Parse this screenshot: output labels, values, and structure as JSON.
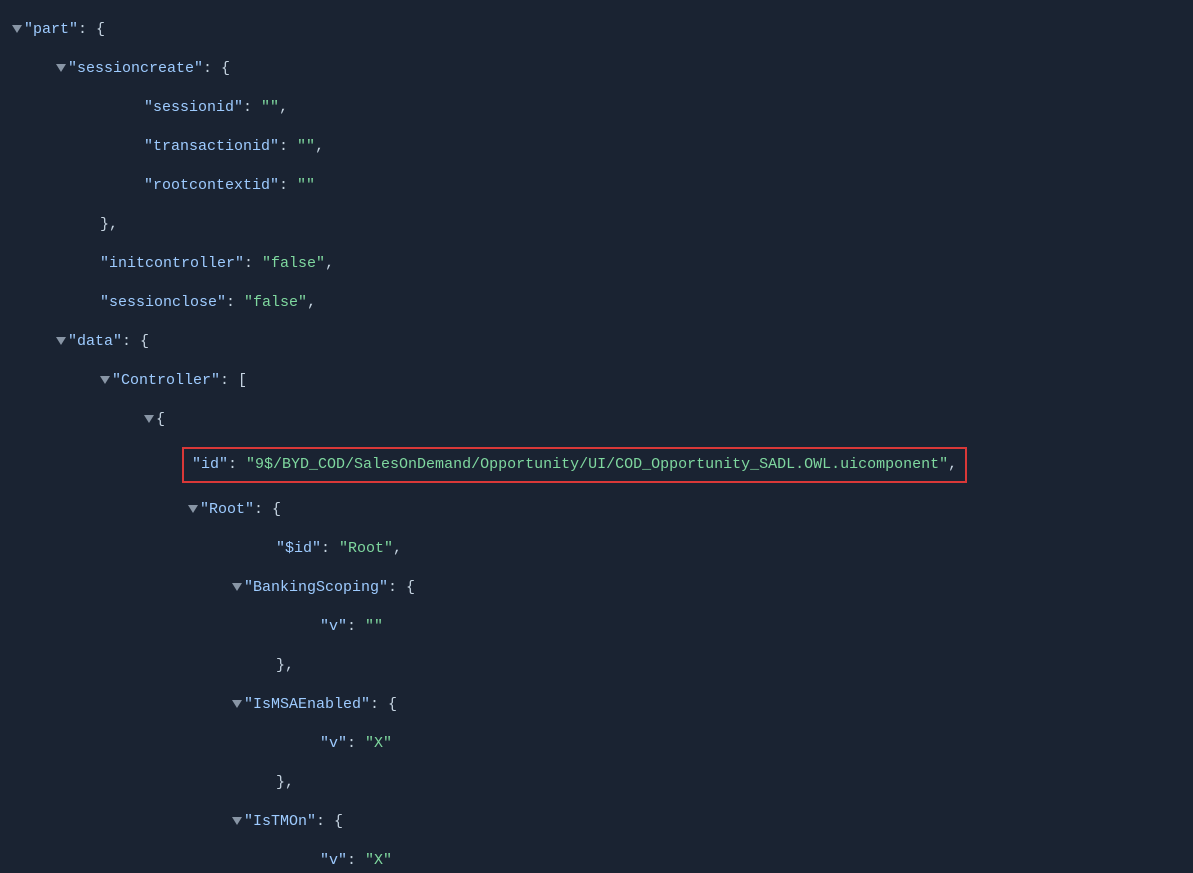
{
  "keys": {
    "part": "\"part\"",
    "sessioncreate": "\"sessioncreate\"",
    "sessionid": "\"sessionid\"",
    "transactionid": "\"transactionid\"",
    "rootcontextid": "\"rootcontextid\"",
    "initcontroller": "\"initcontroller\"",
    "sessionclose": "\"sessionclose\"",
    "data": "\"data\"",
    "controller": "\"Controller\"",
    "id": "\"id\"",
    "root": "\"Root\"",
    "dollarid": "\"$id\"",
    "bankingscoping": "\"BankingScoping\"",
    "v": "\"v\"",
    "ismsaenabled": "\"IsMSAEnabled\"",
    "istmon": "\"IsTMOn\""
  },
  "values": {
    "empty": "\"\"",
    "false": "\"false\"",
    "idvalue": "\"9$/BYD_COD/SalesOnDemand/Opportunity/UI/COD_Opportunity_SADL.OWL.uicomponent\"",
    "rootvalue": "\"Root\"",
    "x": "\"X\""
  },
  "punct": {
    "colon_brace": ": {",
    "colon_bracket": ": [",
    "colon": ": ",
    "comma": ",",
    "brace_close_comma": "},",
    "open_brace": "{"
  }
}
